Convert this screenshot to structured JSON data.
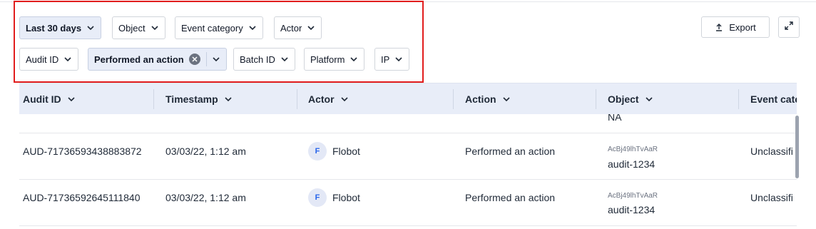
{
  "filters": {
    "row1": [
      {
        "label": "Last 30 days",
        "active": true
      },
      {
        "label": "Object",
        "active": false
      },
      {
        "label": "Event category",
        "active": false
      },
      {
        "label": "Actor",
        "active": false
      }
    ],
    "row2": [
      {
        "label": "Audit ID",
        "active": false
      },
      {
        "label": "Performed an action",
        "active": true,
        "clearable": true
      },
      {
        "label": "Batch ID",
        "active": false
      },
      {
        "label": "Platform",
        "active": false
      },
      {
        "label": "IP",
        "active": false
      }
    ]
  },
  "toolbar": {
    "export_label": "Export"
  },
  "table": {
    "headers": [
      "Audit ID",
      "Timestamp",
      "Actor",
      "Action",
      "Object",
      "Event cate"
    ],
    "partial_row_object": "NA",
    "rows": [
      {
        "audit_id": "AUD-71736593438883872",
        "timestamp": "03/03/22, 1:12 am",
        "actor_initial": "F",
        "actor": "Flobot",
        "action": "Performed an action",
        "object_id": "AcBj49lhTvAaR",
        "object_name": "audit-1234",
        "event_category": "Unclassifi"
      },
      {
        "audit_id": "AUD-71736592645111840",
        "timestamp": "03/03/22, 1:12 am",
        "actor_initial": "F",
        "actor": "Flobot",
        "action": "Performed an action",
        "object_id": "AcBj49lhTvAaR",
        "object_name": "audit-1234",
        "event_category": "Unclassifi"
      }
    ]
  },
  "colors": {
    "highlight": "#e11d1d",
    "active_chip": "#e8edf8",
    "avatar_bg": "#e3e8f6",
    "avatar_text": "#2563eb"
  }
}
